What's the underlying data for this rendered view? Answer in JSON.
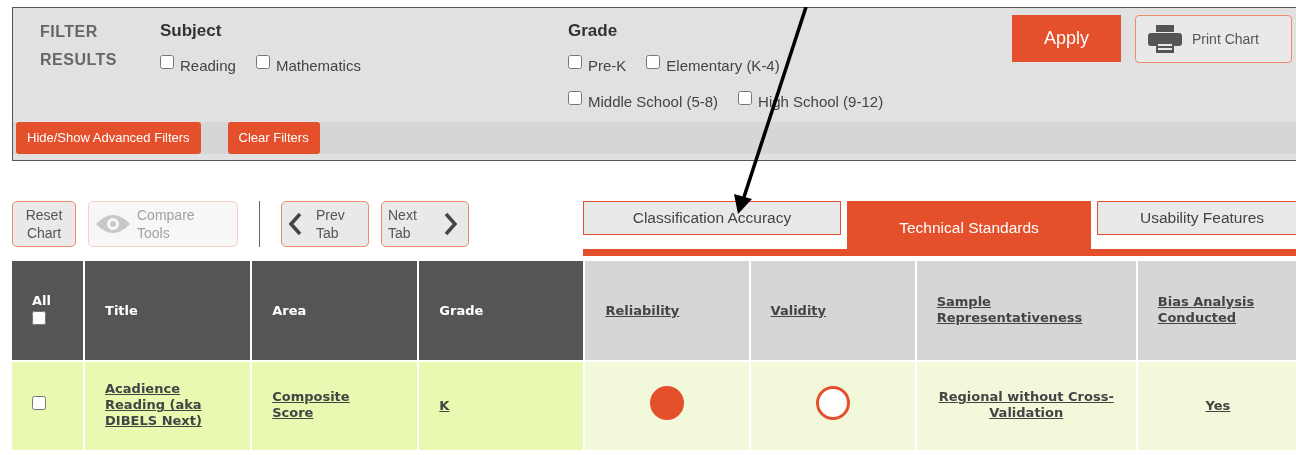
{
  "filter": {
    "title": "FILTER RESULTS",
    "groups": [
      {
        "label": "Subject",
        "options": [
          {
            "label": "Reading",
            "checked": false
          },
          {
            "label": "Mathematics",
            "checked": false
          }
        ]
      },
      {
        "label": "Grade",
        "options": [
          {
            "label": "Pre-K",
            "checked": false
          },
          {
            "label": "Elementary (K-4)",
            "checked": false
          },
          {
            "label": "Middle School (5-8)",
            "checked": false
          },
          {
            "label": "High School (9-12)",
            "checked": false
          }
        ]
      }
    ],
    "apply": "Apply",
    "print": "Print Chart",
    "advanced": "Hide/Show Advanced Filters",
    "clear": "Clear Filters"
  },
  "toolbar": {
    "reset": "Reset Chart",
    "compare": {
      "label": "Compare Tools",
      "disabled": true
    },
    "prev": "Prev Tab",
    "next": "Next Tab"
  },
  "tabs": [
    {
      "label": "Classification Accuracy",
      "selected": false
    },
    {
      "label": "Technical Standards",
      "selected": true
    },
    {
      "label": "Usability Features",
      "selected": false
    }
  ],
  "table": {
    "columns": [
      {
        "kind": "checkbox",
        "label": "All",
        "checked": false
      },
      {
        "kind": "plain",
        "label": "Title"
      },
      {
        "kind": "plain",
        "label": "Area"
      },
      {
        "kind": "plain",
        "label": "Grade"
      },
      {
        "kind": "link",
        "label": "Reliability"
      },
      {
        "kind": "link",
        "label": "Validity"
      },
      {
        "kind": "link",
        "label": "Sample Representativeness"
      },
      {
        "kind": "link",
        "label": "Bias Analysis Conducted"
      }
    ],
    "rows": [
      {
        "cells": [
          {
            "kind": "checkbox",
            "checked": false
          },
          {
            "kind": "link",
            "text": "Acadience Reading (aka DIBELS Next)"
          },
          {
            "kind": "link",
            "text": "Composite Score"
          },
          {
            "kind": "link",
            "text": "K"
          },
          {
            "kind": "rating",
            "filled": true
          },
          {
            "kind": "rating",
            "filled": false
          },
          {
            "kind": "link",
            "text": "Regional without Cross-Validation"
          },
          {
            "kind": "link",
            "text": "Yes"
          }
        ]
      }
    ]
  }
}
